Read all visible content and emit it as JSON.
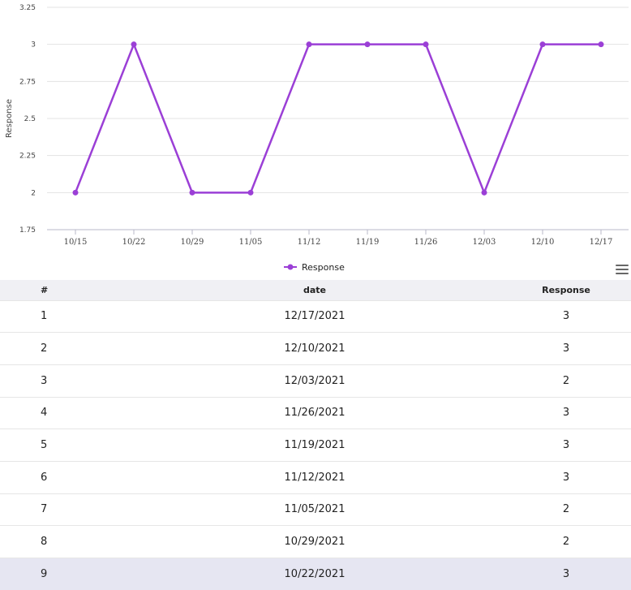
{
  "chart_data": {
    "type": "line",
    "ylabel": "Response",
    "xlabel": "",
    "ylim": [
      1.75,
      3.25
    ],
    "y_ticks": [
      "1.75",
      "2",
      "2.25",
      "2.5",
      "2.75",
      "3",
      "3.25"
    ],
    "y_tick_values": [
      1.75,
      2,
      2.25,
      2.5,
      2.75,
      3,
      3.25
    ],
    "categories": [
      "10/15",
      "10/22",
      "10/29",
      "11/05",
      "11/12",
      "11/19",
      "11/26",
      "12/03",
      "12/10",
      "12/17"
    ],
    "series": [
      {
        "name": "Response",
        "values": [
          2,
          3,
          2,
          2,
          3,
          3,
          3,
          2,
          3,
          3
        ]
      }
    ],
    "grid": true,
    "legend": "bottom-center",
    "line_color": "#9b3fd6"
  },
  "table": {
    "headers": {
      "index": "#",
      "date": "date",
      "response": "Response"
    },
    "rows": [
      {
        "index": "1",
        "date": "12/17/2021",
        "response": "3"
      },
      {
        "index": "2",
        "date": "12/10/2021",
        "response": "3"
      },
      {
        "index": "3",
        "date": "12/03/2021",
        "response": "2"
      },
      {
        "index": "4",
        "date": "11/26/2021",
        "response": "3"
      },
      {
        "index": "5",
        "date": "11/19/2021",
        "response": "3"
      },
      {
        "index": "6",
        "date": "11/12/2021",
        "response": "3"
      },
      {
        "index": "7",
        "date": "11/05/2021",
        "response": "2"
      },
      {
        "index": "8",
        "date": "10/29/2021",
        "response": "2"
      },
      {
        "index": "9",
        "date": "10/22/2021",
        "response": "3"
      }
    ]
  }
}
